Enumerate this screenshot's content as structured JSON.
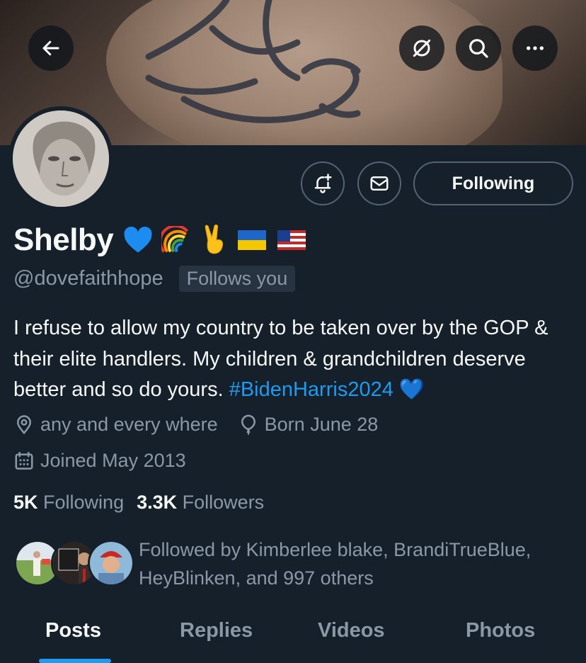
{
  "header": {
    "back_icon": "arrow-left-icon",
    "actions": [
      "notifications-off-icon",
      "search-icon",
      "more-icon"
    ]
  },
  "profile": {
    "name": "Shelby",
    "name_emojis": [
      "💙",
      "🌈",
      "✌️",
      "🇺🇦",
      "🇺🇸"
    ],
    "handle": "@dovefaithhope",
    "follows_you": "Follows you",
    "following_button": "Following",
    "bio_text": "I refuse to allow my country to be taken over by the GOP & their elite handlers. My children & grandchildren deserve better and so do yours. ",
    "bio_hashtag": "#BidenHarris2024",
    "bio_emoji": "💙",
    "location": "any and every where",
    "birthday": "Born June 28",
    "joined": "Joined May 2013"
  },
  "stats": {
    "following_count": "5K",
    "following_label": "Following",
    "followers_count": "3.3K",
    "followers_label": "Followers"
  },
  "followed_by": {
    "text": "Followed by Kimberlee blake, BrandiTrueBlue, HeyBlinken, and 997 others"
  },
  "tabs": {
    "items": [
      "Posts",
      "Replies",
      "Videos",
      "Photos"
    ],
    "active": "Posts"
  },
  "colors": {
    "background": "#15202b",
    "accent": "#1d9bf0",
    "secondary_text": "#8b98a5",
    "border": "#536471"
  }
}
